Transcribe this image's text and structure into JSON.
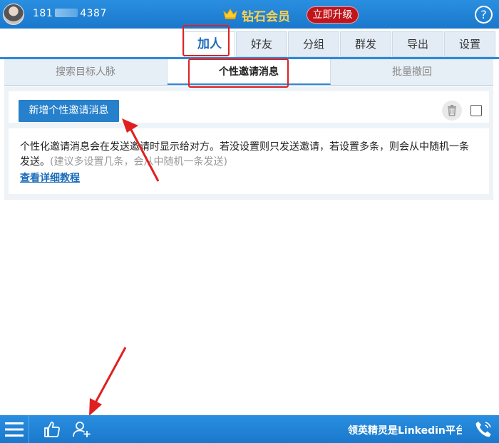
{
  "header": {
    "phone_prefix": "181",
    "phone_suffix": "4387",
    "membership": "钻石会员",
    "upgrade_label": "立即升级",
    "help_symbol": "?"
  },
  "tabs": [
    {
      "label": "加人",
      "active": true
    },
    {
      "label": "好友",
      "active": false
    },
    {
      "label": "分组",
      "active": false
    },
    {
      "label": "群发",
      "active": false
    },
    {
      "label": "导出",
      "active": false
    },
    {
      "label": "设置",
      "active": false
    }
  ],
  "subtabs": [
    {
      "label": "搜索目标人脉",
      "active": false
    },
    {
      "label": "个性邀请消息",
      "active": true
    },
    {
      "label": "批量撤回",
      "active": false
    }
  ],
  "toolbar": {
    "add_label": "新增个性邀请消息"
  },
  "info": {
    "text": "个性化邀请消息会在发送邀请时显示给对方。若没设置则只发送邀请，若设置多条，则会从中随机一条发送。",
    "hint": "(建议多设置几条，会从中随机一条发送)",
    "link": "查看详细教程"
  },
  "footer": {
    "ticker": "领英精灵是Linkedin平台"
  },
  "colors": {
    "primary": "#1a78cc",
    "accent_gold": "#ffd24a",
    "upgrade_red": "#c0151b",
    "highlight_red": "#e02020"
  },
  "icons": [
    "menu-icon",
    "thumbs-up-icon",
    "add-user-icon",
    "phone-icon",
    "trash-icon",
    "crown-icon",
    "help-icon"
  ]
}
